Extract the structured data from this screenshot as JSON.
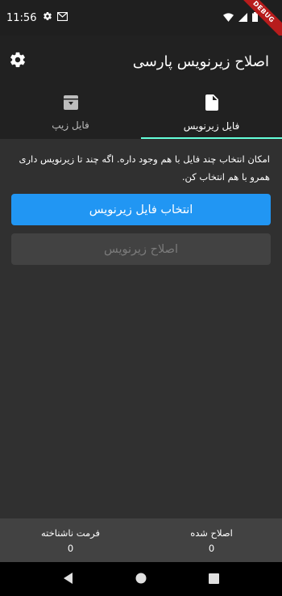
{
  "status_bar": {
    "time": "11:56",
    "debug_label": "DEBUG",
    "icons": [
      "gear-icon",
      "gmail-icon",
      "wifi-icon",
      "signal-icon",
      "battery-icon"
    ]
  },
  "app_bar": {
    "title": "اصلاح زیرنویس پارسی",
    "settings_icon": "gear-icon"
  },
  "tabs": [
    {
      "label": "فایل زیرنویس",
      "icon": "file-icon",
      "active": true
    },
    {
      "label": "فایل زیپ",
      "icon": "archive-icon",
      "active": false
    }
  ],
  "main": {
    "info_text": "امکان انتخاب چند فایل با هم وجود داره. اگه چند تا زیرنویس داری همرو با هم انتخاب کن.",
    "select_button_label": "انتخاب فایل زیرنویس",
    "fix_button_label": "اصلاح زیرنویس"
  },
  "stats": {
    "fixed_label": "اصلاح شده",
    "fixed_value": "0",
    "unknown_label": "فرمت ناشناخته",
    "unknown_value": "0"
  },
  "colors": {
    "accent": "#64ffda",
    "primary": "#2196f3",
    "background": "#303030",
    "app_bar": "#212121"
  }
}
